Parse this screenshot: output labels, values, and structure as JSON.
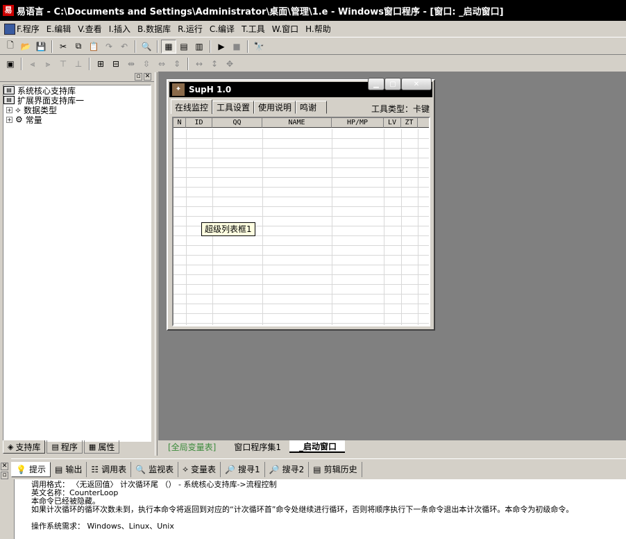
{
  "window": {
    "title": "易语言 - C:\\Documents and Settings\\Administrator\\桌面\\管理\\1.e - Windows窗口程序 - [窗口: _启动窗口]",
    "app_icon": "易"
  },
  "menu": [
    {
      "label": "F.程序"
    },
    {
      "label": "E.编辑"
    },
    {
      "label": "V.查看"
    },
    {
      "label": "I.插入"
    },
    {
      "label": "B.数据库"
    },
    {
      "label": "R.运行"
    },
    {
      "label": "C.编译"
    },
    {
      "label": "T.工具"
    },
    {
      "label": "W.窗口"
    },
    {
      "label": "H.帮助"
    }
  ],
  "tree": [
    {
      "label": "系统核心支持库",
      "icon": "book-icon"
    },
    {
      "label": "扩展界面支持库一",
      "icon": "book-icon"
    },
    {
      "label": "数据类型",
      "icon": "datatype-icon"
    },
    {
      "label": "常量",
      "icon": "constant-icon"
    }
  ],
  "left_tabs": [
    {
      "label": "支持库"
    },
    {
      "label": "程序"
    },
    {
      "label": "属性"
    }
  ],
  "doc_tabs": [
    {
      "label": "[全局变量表]"
    },
    {
      "label": "窗口程序集1"
    },
    {
      "label": "_启动窗口"
    }
  ],
  "form": {
    "title": "SupH 1.0",
    "tabs": [
      {
        "label": "在线监控"
      },
      {
        "label": "工具设置"
      },
      {
        "label": "使用说明"
      },
      {
        "label": "鸣谢"
      }
    ],
    "tool_type": "工具类型：卡键",
    "columns": [
      "N",
      "ID",
      "QQ",
      "NAME",
      "HP/MP",
      "LV",
      "ZT"
    ],
    "tooltip": "超级列表框1"
  },
  "bottom_tabs": [
    {
      "label": "提示"
    },
    {
      "label": "输出"
    },
    {
      "label": "调用表"
    },
    {
      "label": "监视表"
    },
    {
      "label": "变量表"
    },
    {
      "label": "搜寻1"
    },
    {
      "label": "搜寻2"
    },
    {
      "label": "剪辑历史"
    }
  ],
  "help": {
    "line1": "调用格式： 〈无返回值〉 计次循环尾 （） - 系统核心支持库->流程控制",
    "line2": "英文名称：CounterLoop",
    "line3": "本命令已经被隐藏。",
    "line4": "如果计次循环的循环次数未到，执行本命令将返回到对应的“计次循环首”命令处继续进行循环，否则将顺序执行下一条命令退出本计次循环。本命令为初级命令。",
    "line5": "操作系统需求： Windows、Linux、Unix"
  }
}
